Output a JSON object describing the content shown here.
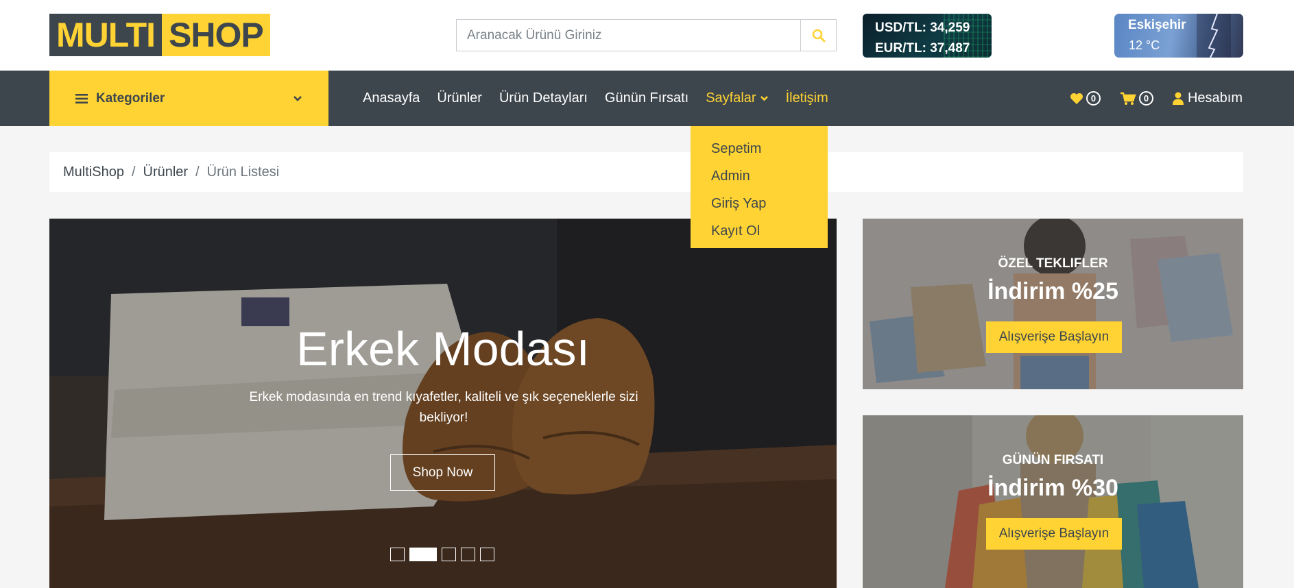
{
  "logo": {
    "part1": "MULTI",
    "part2": "SHOP"
  },
  "search": {
    "placeholder": "Aranacak Ürünü Giriniz"
  },
  "currency": {
    "usd": "USD/TL: 34,259",
    "eur": "EUR/TL: 37,487"
  },
  "weather": {
    "city": "Eskişehir",
    "temp": "12 °C"
  },
  "nav": {
    "categories_label": "Kategoriler",
    "items": [
      "Anasayfa",
      "Ürünler",
      "Ürün Detayları",
      "Günün Fırsatı",
      "Sayfalar",
      "İletişim"
    ],
    "wishlist_count": "0",
    "cart_count": "0",
    "account_label": "Hesabım"
  },
  "dropdown": {
    "items": [
      "Sepetim",
      "Admin",
      "Giriş Yap",
      "Kayıt Ol"
    ]
  },
  "breadcrumb": {
    "items": [
      "MultiShop",
      "Ürünler"
    ],
    "current": "Ürün Listesi"
  },
  "hero": {
    "title": "Erkek Modası",
    "subtitle": "Erkek modasında en trend kıyafetler, kaliteli ve şık seçeneklerle sizi bekliyor!",
    "button": "Shop Now",
    "active_slide": 2,
    "slide_count": 5
  },
  "promos": [
    {
      "kicker": "ÖZEL TEKLIFLER",
      "headline": "İndirim %25",
      "button": "Alışverişe Başlayın"
    },
    {
      "kicker": "GÜNÜN FIRSATI",
      "headline": "İndirim %30",
      "button": "Alışverişe Başlayın"
    }
  ],
  "colors": {
    "accent": "#ffd333",
    "dark": "#3d464d",
    "background": "#f5f5f5"
  },
  "icons": [
    "search-icon",
    "bars-icon",
    "chevron-down-icon",
    "heart-icon",
    "cart-icon",
    "user-icon"
  ]
}
